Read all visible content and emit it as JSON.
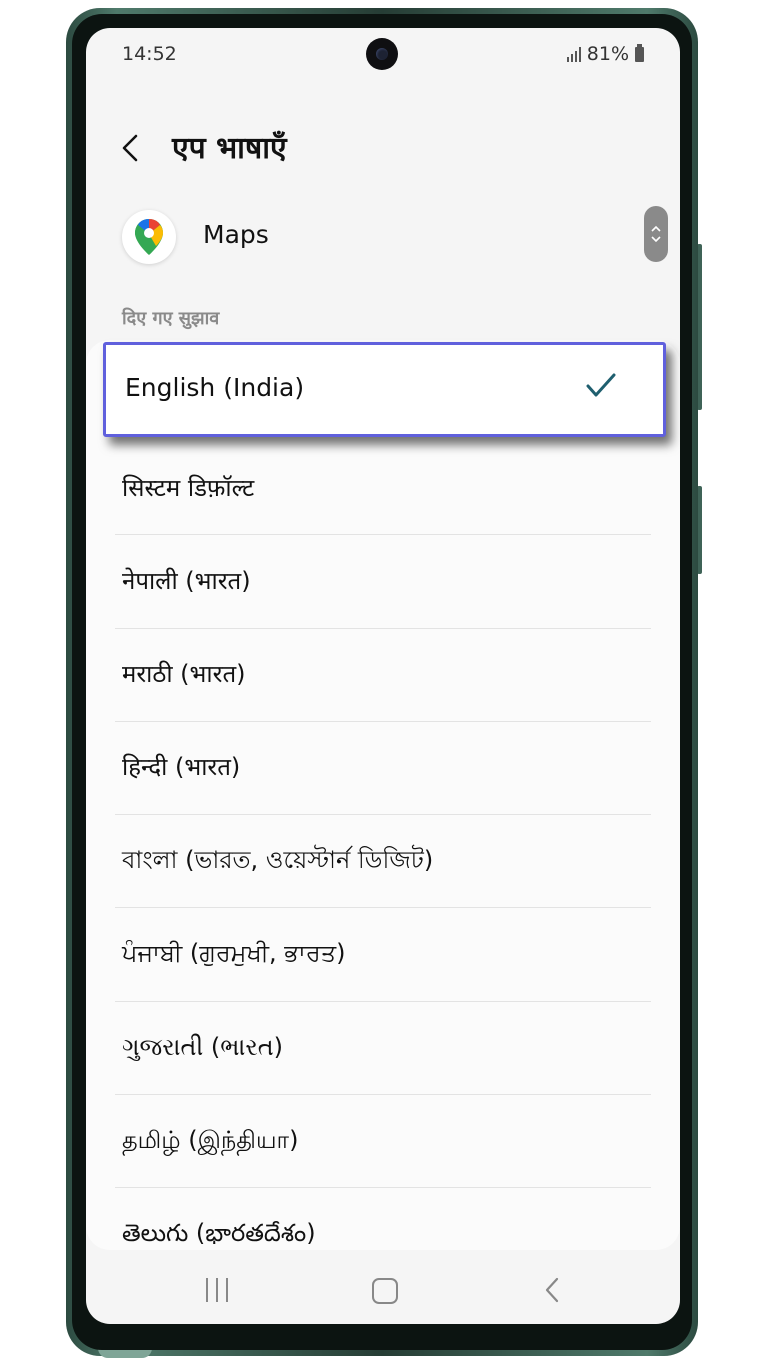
{
  "status_bar": {
    "time": "14:52",
    "battery_percent": "81%",
    "icons": [
      "signal-icon",
      "battery-icon"
    ]
  },
  "header": {
    "title": "एप भाषाएँ",
    "back_icon": "chevron-left-icon"
  },
  "app": {
    "name": "Maps",
    "icon": "google-maps-icon"
  },
  "section": {
    "label": "दिए गए सुझाव"
  },
  "selected_language": {
    "label": "English (India)",
    "checked": true,
    "check_color": "#1f5f6f",
    "highlight_color": "#6060dd"
  },
  "languages": [
    {
      "label": "सिस्टम डिफ़ॉल्ट"
    },
    {
      "label": "नेपाली (भारत)"
    },
    {
      "label": "मराठी (भारत)"
    },
    {
      "label": "हिन्दी (भारत)"
    },
    {
      "label": "বাংলা (ভারত, ওয়েস্টার্ন ডিজিট)"
    },
    {
      "label": "ਪੰਜਾਬੀ (ਗੁਰਮੁਖੀ, ਭਾਰਤ)"
    },
    {
      "label": "ગુજરાતી (ભારત)"
    },
    {
      "label": "தமிழ் (இந்தியா)"
    },
    {
      "label": "తెలుగు (భారతదేశం)"
    }
  ],
  "nav_bar": {
    "icons": [
      "recents-icon",
      "home-icon",
      "back-icon"
    ]
  },
  "colors": {
    "screen_bg": "#f5f5f5",
    "list_bg": "#fbfbfb",
    "frame": "#2c4a40"
  }
}
